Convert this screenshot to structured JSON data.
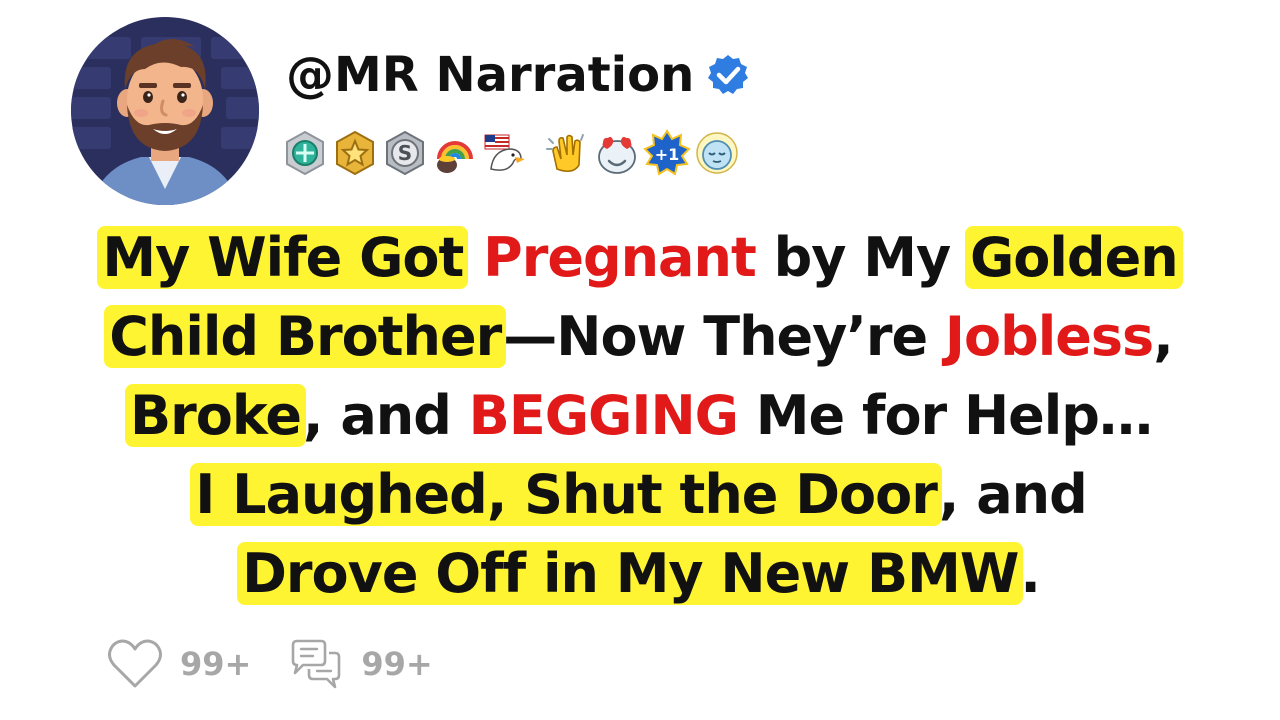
{
  "profile": {
    "username": "@MR Narration",
    "verified": true,
    "accent_color": "#2f7de1",
    "badges": [
      {
        "name": "emerald-medal"
      },
      {
        "name": "gold-star-badge"
      },
      {
        "name": "silver-s-badge"
      },
      {
        "name": "rainbow-pot-of-gold"
      },
      {
        "name": "eagle-flag"
      },
      {
        "name": "clapping-hands"
      },
      {
        "name": "heart-eyes-face"
      },
      {
        "name": "plus-one-star"
      },
      {
        "name": "sleeping-moon-face"
      }
    ]
  },
  "headline": {
    "line1": {
      "a": "My Wife Got",
      "b": "Pregnant",
      "c": "by My",
      "d": "Golden"
    },
    "line2": {
      "a": "Child Brother",
      "b": "—Now They’re",
      "c": "Jobless",
      "d": ","
    },
    "line3": {
      "a": "Broke",
      "b": ", and",
      "c": "BEGGING",
      "d": "Me for Help…"
    },
    "line4": {
      "a": "I Laughed, Shut the Door",
      "b": ", and"
    },
    "line5": {
      "a": "Drove Off in My New BMW",
      "b": "."
    },
    "highlight_color": "#fff432",
    "emphasis_color": "#e11919"
  },
  "actions": {
    "likes": "99+",
    "comments": "99+"
  }
}
